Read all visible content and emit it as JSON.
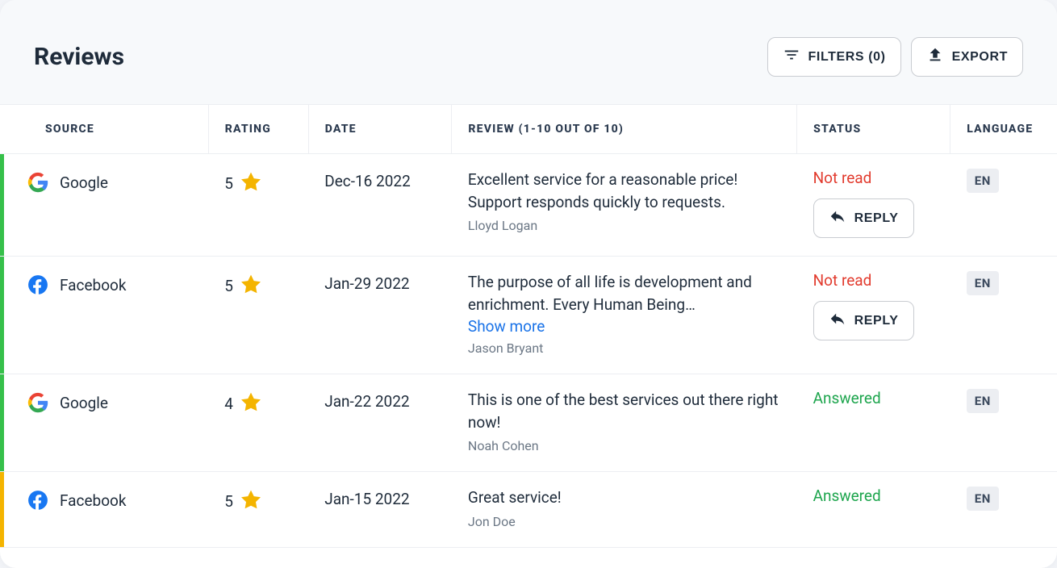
{
  "header": {
    "title": "Reviews",
    "filters_label": "FILTERS (0)",
    "export_label": "EXPORT"
  },
  "columns": {
    "source": "SOURCE",
    "rating": "RATING",
    "date": "DATE",
    "review": "REVIEW (1-10 OUT OF 10)",
    "status": "STATUS",
    "language": "LANGUAGE"
  },
  "labels": {
    "reply": "REPLY",
    "show_more": "Show more"
  },
  "rows": [
    {
      "accent": "green",
      "source": "Google",
      "source_icon": "google",
      "rating": "5",
      "date": "Dec-16 2022",
      "review_text": "Excellent service for a reasonable price! Support responds quickly to requests.",
      "truncated": false,
      "reviewer": "Lloyd Logan",
      "status": "Not read",
      "status_kind": "notread",
      "can_reply": true,
      "language": "EN"
    },
    {
      "accent": "green",
      "source": "Facebook",
      "source_icon": "facebook",
      "rating": "5",
      "date": "Jan-29 2022",
      "review_text": "The purpose of all life is development and enrichment. Every Human Being…",
      "truncated": true,
      "reviewer": "Jason Bryant",
      "status": "Not read",
      "status_kind": "notread",
      "can_reply": true,
      "language": "EN"
    },
    {
      "accent": "green",
      "source": "Google",
      "source_icon": "google",
      "rating": "4",
      "date": "Jan-22 2022",
      "review_text": "This is one of the best services out there right now!",
      "truncated": false,
      "reviewer": "Noah Cohen",
      "status": "Answered",
      "status_kind": "answered",
      "can_reply": false,
      "language": "EN"
    },
    {
      "accent": "yellow",
      "source": "Facebook",
      "source_icon": "facebook",
      "rating": "5",
      "date": "Jan-15 2022",
      "review_text": "Great service!",
      "truncated": false,
      "reviewer": "Jon Doe",
      "status": "Answered",
      "status_kind": "answered",
      "can_reply": false,
      "language": "EN"
    }
  ]
}
